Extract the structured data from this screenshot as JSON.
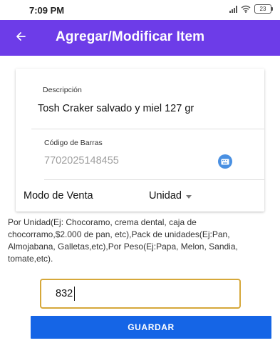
{
  "status_bar": {
    "time": "7:09 PM",
    "battery": "23",
    "icons": [
      "signal-icon",
      "wifi-icon",
      "battery-icon"
    ]
  },
  "app_bar": {
    "title": "Agregar/Modificar Item",
    "back_icon": "arrow-left-icon",
    "color": "#6d3ce8"
  },
  "form": {
    "descripcion": {
      "label": "Descripción",
      "value": "Tosh Craker salvado y miel 127 gr"
    },
    "codigo_barras": {
      "label": "Código de Barras",
      "value": "7702025148455",
      "action_icon": "keyboard-icon"
    },
    "modo_venta": {
      "label": "Modo de Venta",
      "selected": "Unidad"
    },
    "help_text": "Por Unidad(Ej: Chocoramo, crema dental, caja de chocorramo,$2.000 de pan, etc),Pack de unidades(Ej:Pan, Almojabana, Galletas,etc),Por Peso(Ej:Papa, Melon, Sandia, tomate,etc).",
    "cantidad": {
      "value": "832",
      "border_color": "#d6a83a"
    },
    "save_button": {
      "label": "GUARDAR",
      "color": "#1565e6"
    }
  }
}
